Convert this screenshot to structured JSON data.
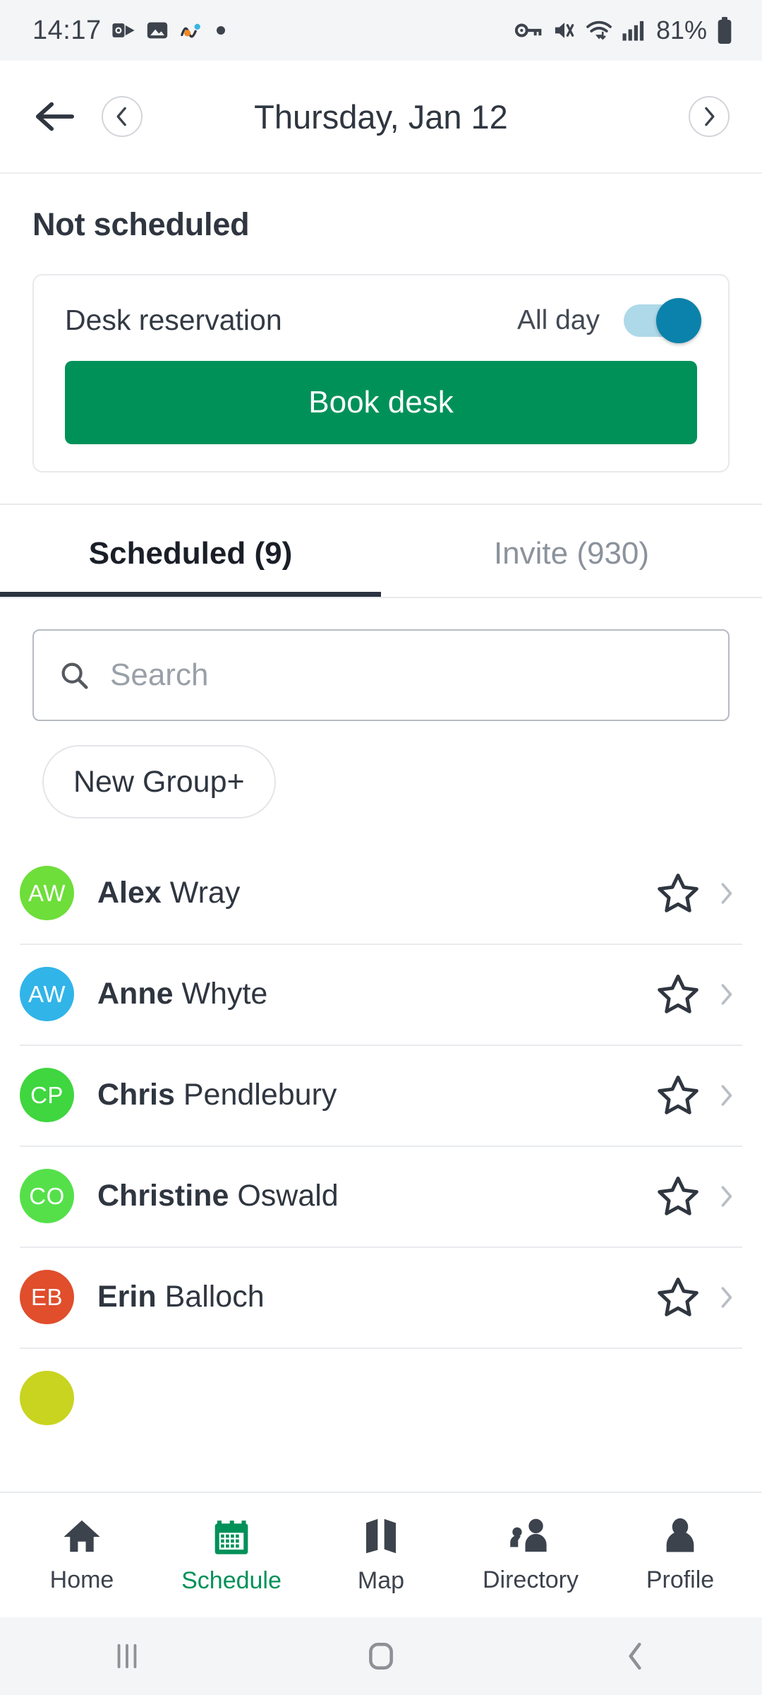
{
  "status_bar": {
    "time": "14:17",
    "battery_percent": "81%",
    "left_icons": [
      "outlook-icon",
      "photos-icon",
      "activity-icon",
      "dot-icon"
    ],
    "right_icons": [
      "vpn-key-icon",
      "mute-icon",
      "wifi-icon",
      "signal-icon",
      "battery-icon"
    ]
  },
  "header": {
    "back_label": "back-arrow",
    "prev_label": "previous-day",
    "next_label": "next-day",
    "date": "Thursday, Jan 12"
  },
  "schedule": {
    "section_title": "Not scheduled",
    "card": {
      "label": "Desk reservation",
      "all_day_label": "All day",
      "all_day_on": true,
      "book_label": "Book desk"
    }
  },
  "tabs": [
    {
      "label": "Scheduled (9)",
      "active": true
    },
    {
      "label": "Invite (930)",
      "active": false
    }
  ],
  "search": {
    "placeholder": "Search",
    "value": ""
  },
  "chips": [
    {
      "label": "New Group+"
    }
  ],
  "contacts": [
    {
      "initials": "AW",
      "first": "Alex",
      "last": "Wray",
      "color": "#6ede3a",
      "starred": false
    },
    {
      "initials": "AW",
      "first": "Anne",
      "last": "Whyte",
      "color": "#31b4e8",
      "starred": false
    },
    {
      "initials": "CP",
      "first": "Chris",
      "last": "Pendlebury",
      "color": "#3fd63f",
      "starred": false
    },
    {
      "initials": "CO",
      "first": "Christine",
      "last": "Oswald",
      "color": "#55e04a",
      "starred": false
    },
    {
      "initials": "EB",
      "first": "Erin",
      "last": "Balloch",
      "color": "#e04e2c",
      "starred": false
    },
    {
      "initials": "",
      "first": "",
      "last": "",
      "color": "#c8d420",
      "starred": false
    }
  ],
  "bottom_nav": [
    {
      "label": "Home",
      "icon": "home-icon",
      "active": false
    },
    {
      "label": "Schedule",
      "icon": "calendar-icon",
      "active": true
    },
    {
      "label": "Map",
      "icon": "map-icon",
      "active": false
    },
    {
      "label": "Directory",
      "icon": "people-icon",
      "active": false
    },
    {
      "label": "Profile",
      "icon": "person-icon",
      "active": false
    }
  ],
  "system_nav": {
    "recents": "recents-icon",
    "home": "home-square-icon",
    "back": "back-chevron-icon"
  },
  "colors": {
    "brand_green": "#009159",
    "toggle_on": "#0b82ab",
    "toggle_track": "#aed9e8",
    "text_primary": "#2f3640",
    "text_muted": "#8b929c"
  }
}
